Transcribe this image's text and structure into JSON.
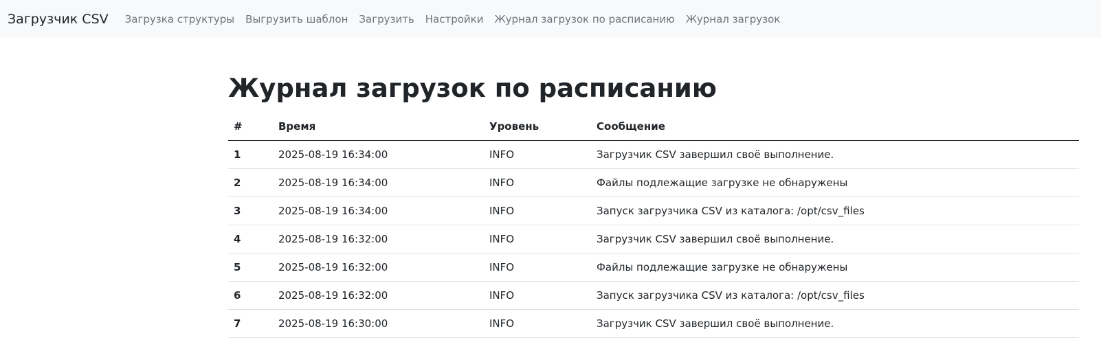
{
  "navbar": {
    "brand": "Загрузчик CSV",
    "links": [
      "Загрузка структуры",
      "Выгрузить шаблон",
      "Загрузить",
      "Настройки",
      "Журнал загрузок по расписанию",
      "Журнал загрузок"
    ]
  },
  "page": {
    "title": "Журнал загрузок по расписанию"
  },
  "table": {
    "headers": [
      "#",
      "Время",
      "Уровень",
      "Сообщение"
    ],
    "rows": [
      {
        "num": "1",
        "time": "2025-08-19 16:34:00",
        "level": "INFO",
        "message": "Загрузчик CSV завершил своё выполнение."
      },
      {
        "num": "2",
        "time": "2025-08-19 16:34:00",
        "level": "INFO",
        "message": "Файлы подлежащие загрузке не обнаружены"
      },
      {
        "num": "3",
        "time": "2025-08-19 16:34:00",
        "level": "INFO",
        "message": "Запуск загрузчика CSV из каталога: /opt/csv_files"
      },
      {
        "num": "4",
        "time": "2025-08-19 16:32:00",
        "level": "INFO",
        "message": "Загрузчик CSV завершил своё выполнение."
      },
      {
        "num": "5",
        "time": "2025-08-19 16:32:00",
        "level": "INFO",
        "message": "Файлы подлежащие загрузке не обнаружены"
      },
      {
        "num": "6",
        "time": "2025-08-19 16:32:00",
        "level": "INFO",
        "message": "Запуск загрузчика CSV из каталога: /opt/csv_files"
      },
      {
        "num": "7",
        "time": "2025-08-19 16:30:00",
        "level": "INFO",
        "message": "Загрузчик CSV завершил своё выполнение."
      }
    ]
  }
}
